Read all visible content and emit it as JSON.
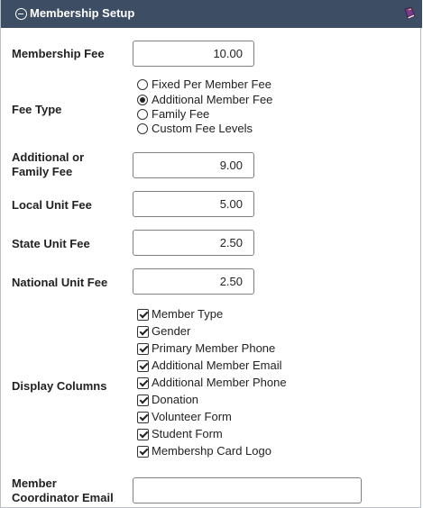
{
  "header": {
    "title": "Membership Setup",
    "left_icon": "minus-circle-icon",
    "right_icon": "book-icon"
  },
  "fields": {
    "membership_fee": {
      "label": "Membership Fee",
      "value": "10.00"
    },
    "fee_type": {
      "label": "Fee Type",
      "options": [
        "Fixed Per Member Fee",
        "Additional Member Fee",
        "Family Fee",
        "Custom Fee Levels"
      ],
      "selected": "Additional Member Fee"
    },
    "additional_family_fee": {
      "label_line1": "Additional or",
      "label_line2": "Family Fee",
      "value": "9.00"
    },
    "local_unit_fee": {
      "label": "Local Unit Fee",
      "value": "5.00"
    },
    "state_unit_fee": {
      "label": "State Unit Fee",
      "value": "2.50"
    },
    "national_unit_fee": {
      "label": "National Unit Fee",
      "value": "2.50"
    },
    "display_columns": {
      "label": "Display Columns",
      "items": [
        {
          "label": "Member Type",
          "checked": true
        },
        {
          "label": "Gender",
          "checked": true
        },
        {
          "label": "Primary Member Phone",
          "checked": true
        },
        {
          "label": "Additional Member Email",
          "checked": true
        },
        {
          "label": "Additional Member Phone",
          "checked": true
        },
        {
          "label": "Donation",
          "checked": true
        },
        {
          "label": "Volunteer Form",
          "checked": true
        },
        {
          "label": "Student Form",
          "checked": true
        },
        {
          "label": "Membershp Card Logo",
          "checked": true
        }
      ]
    },
    "coordinator_email": {
      "label_line1": "Member",
      "label_line2": "Coordinator Email",
      "value": ""
    }
  },
  "colors": {
    "header_bg": "#3d4d63",
    "header_text": "#ffffff"
  }
}
